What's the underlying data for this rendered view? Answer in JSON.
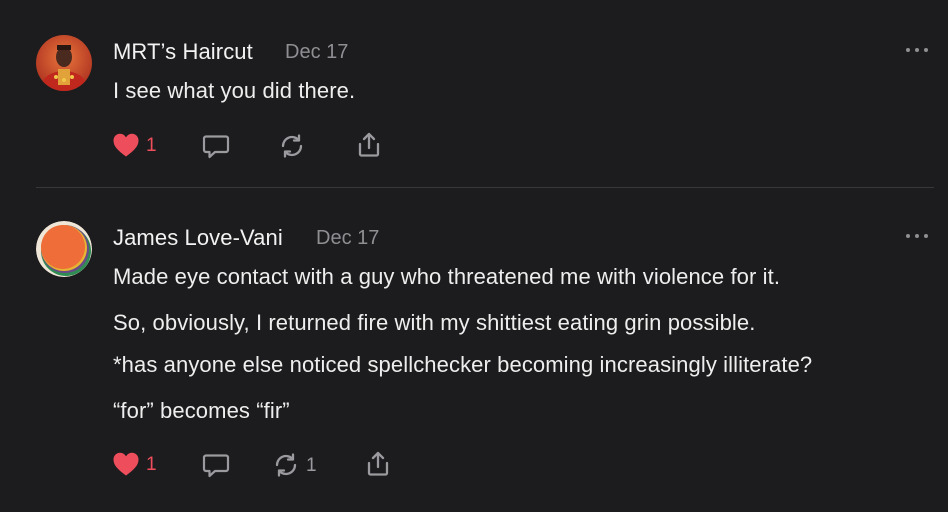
{
  "posts": [
    {
      "author": "MRT’s Haircut",
      "date": "Dec 17",
      "lines": [
        "I see what you did there."
      ],
      "actions": {
        "like_count": "1",
        "repost_count": ""
      }
    },
    {
      "author": "James Love-Vani",
      "date": "Dec 17",
      "lines": [
        "Made eye contact with a guy who threatened me with violence for it.",
        "So, obviously, I returned fire with my shittiest eating grin possible.",
        "*has anyone else noticed spellchecker becoming increasingly illiterate?",
        "“for” becomes “fir”"
      ],
      "actions": {
        "like_count": "1",
        "repost_count": "1"
      }
    }
  ],
  "colors": {
    "background": "#1c1c1e",
    "like": "#ee4e5b",
    "muted": "#8e8e93",
    "text": "#eeeeee"
  },
  "icons": [
    "heart-icon",
    "comment-icon",
    "repost-icon",
    "share-icon",
    "more-icon"
  ]
}
